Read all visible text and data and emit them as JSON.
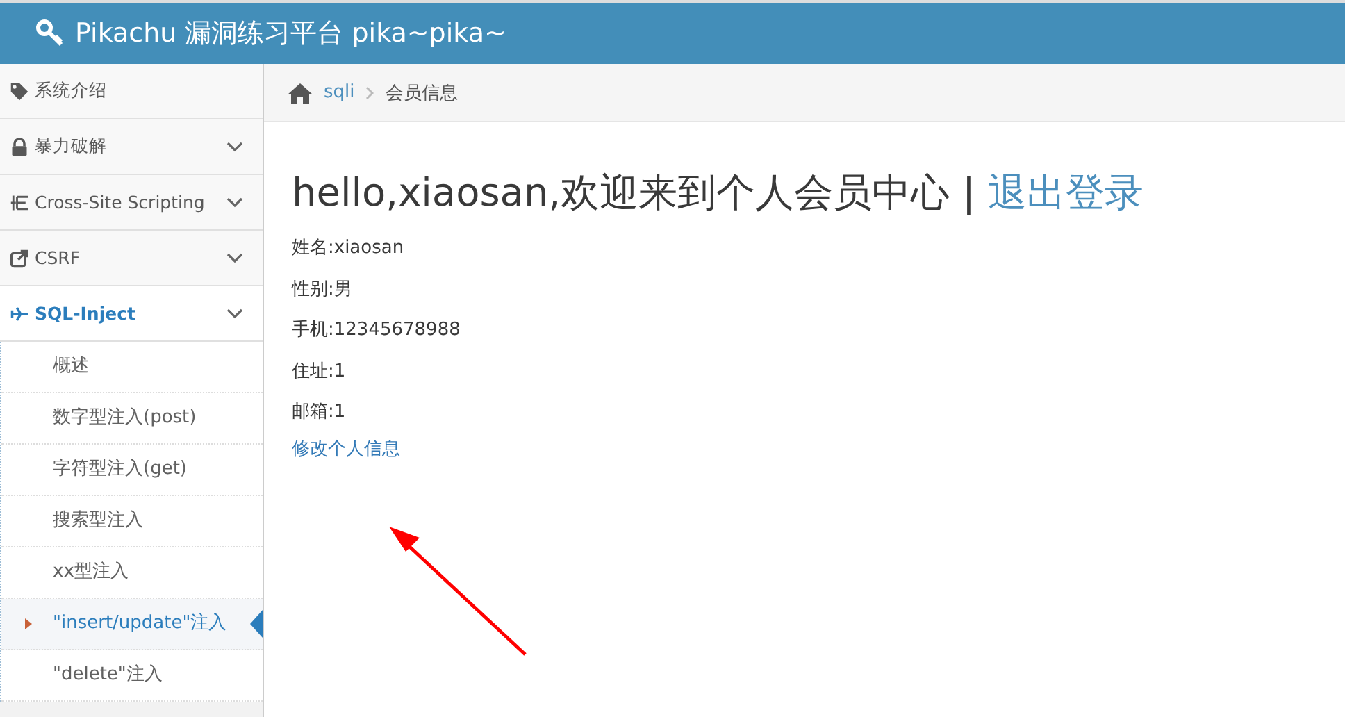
{
  "header": {
    "title": "Pikachu 漏洞练习平台 pika~pika~"
  },
  "sidebar": {
    "items": [
      {
        "kind": "link",
        "label": "系统介绍",
        "selected": false
      },
      {
        "kind": "group",
        "label": "暴力破解",
        "selected": false
      },
      {
        "kind": "group",
        "label": "Cross-Site Scripting",
        "selected": false
      },
      {
        "kind": "group",
        "label": "CSRF",
        "selected": false
      },
      {
        "kind": "group",
        "label": "SQL-Inject",
        "selected": true,
        "children": [
          {
            "label": "概述",
            "selected": false
          },
          {
            "label": "数字型注入(post)",
            "selected": false
          },
          {
            "label": "字符型注入(get)",
            "selected": false
          },
          {
            "label": "搜索型注入",
            "selected": false
          },
          {
            "label": "xx型注入",
            "selected": false
          },
          {
            "label": "\"insert/update\"注入",
            "selected": true
          },
          {
            "label": "\"delete\"注入",
            "selected": false
          }
        ]
      }
    ]
  },
  "breadcrumb": [
    "sqli",
    "会员信息"
  ],
  "heading": {
    "text": "hello,xiaosan,欢迎来到个人会员中心 |",
    "link": "退出登录"
  },
  "fields": [
    "姓名:xiaosan",
    "性别:男",
    "手机:12345678988",
    "住址:1",
    "邮箱:1"
  ],
  "edit_link": "修改个人信息"
}
